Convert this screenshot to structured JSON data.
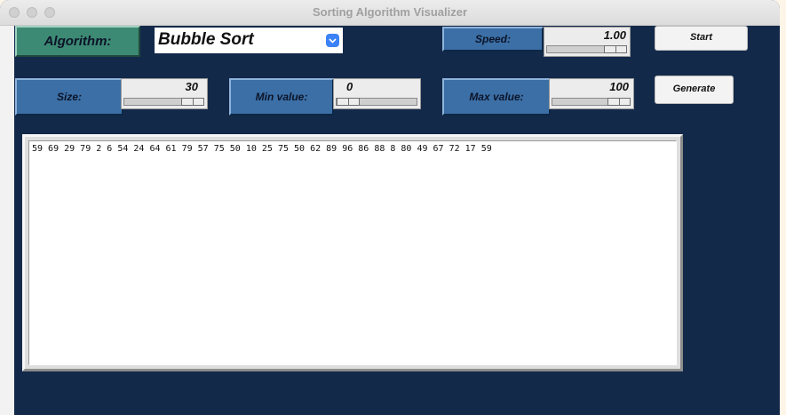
{
  "window": {
    "title": "Sorting Algorithm Visualizer"
  },
  "algorithm": {
    "label": "Algorithm:",
    "selected": "Bubble Sort"
  },
  "speed": {
    "label": "Speed:",
    "value": "1.00",
    "level": 0.5
  },
  "start_label": "Start",
  "size": {
    "label": "Size:",
    "value": "30",
    "level": 0.55
  },
  "min_value": {
    "label": "Min value:",
    "value": "0",
    "level": 0.0
  },
  "max_value": {
    "label": "Max value:",
    "value": "100",
    "level": 0.62
  },
  "generate_label": "Generate",
  "array_text": "59 69 29 79 2 6 54 24 64 61 79 57 75 50 10 25 75 50 62 89 96 86 88 8 80 49 67 72 17 59",
  "colors": {
    "background": "#13294a",
    "label_blue": "#3b6fa6",
    "label_green": "#3d8a74",
    "chevron": "#3b82f6"
  }
}
